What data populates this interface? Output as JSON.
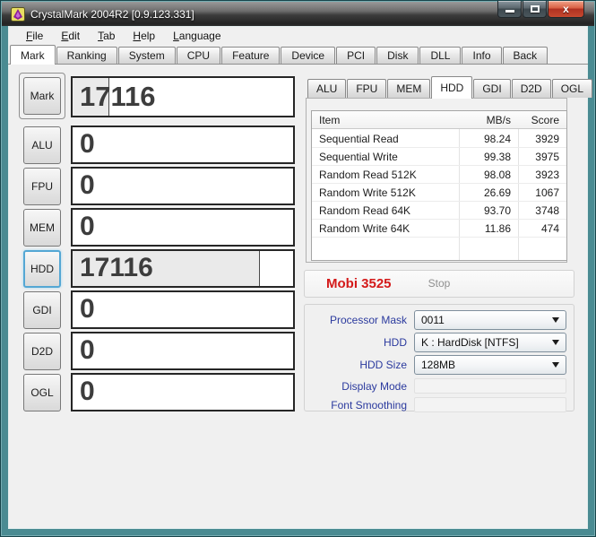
{
  "window": {
    "title": "CrystalMark 2004R2 [0.9.123.331]",
    "icons": [
      "app-icon",
      "minimize-icon",
      "maximize-icon",
      "close-icon",
      "dropdown-arrow-icon"
    ],
    "close_glyph": "x"
  },
  "menu": {
    "items": [
      {
        "mnemonic": "F",
        "rest": "ile"
      },
      {
        "mnemonic": "E",
        "rest": "dit"
      },
      {
        "mnemonic": "T",
        "rest": "ab"
      },
      {
        "mnemonic": "H",
        "rest": "elp"
      },
      {
        "mnemonic": "L",
        "rest": "anguage"
      }
    ]
  },
  "main_tabs": {
    "items": [
      "Mark",
      "Ranking",
      "System",
      "CPU",
      "Feature",
      "Device",
      "PCI",
      "Disk",
      "DLL",
      "Info",
      "Back"
    ],
    "active": "Mark"
  },
  "left_panel": {
    "rows": [
      {
        "button": "Mark",
        "value": "17116",
        "fill": 16.5
      },
      {
        "button": "ALU",
        "value": "0",
        "fill": 0
      },
      {
        "button": "FPU",
        "value": "0",
        "fill": 0
      },
      {
        "button": "MEM",
        "value": "0",
        "fill": 0
      },
      {
        "button": "HDD",
        "value": "17116",
        "fill": 85
      },
      {
        "button": "GDI",
        "value": "0",
        "fill": 0
      },
      {
        "button": "D2D",
        "value": "0",
        "fill": 0
      },
      {
        "button": "OGL",
        "value": "0",
        "fill": 0
      }
    ]
  },
  "results": {
    "tabs": [
      "ALU",
      "FPU",
      "MEM",
      "HDD",
      "GDI",
      "D2D",
      "OGL"
    ],
    "active": "HDD",
    "table": {
      "headers": [
        "Item",
        "MB/s",
        "Score"
      ],
      "rows": [
        [
          "Sequential Read",
          "98.24",
          "3929"
        ],
        [
          "Sequential Write",
          "99.38",
          "3975"
        ],
        [
          "Random Read 512K",
          "98.08",
          "3923"
        ],
        [
          "Random Write 512K",
          "26.69",
          "1067"
        ],
        [
          "Random Read 64K",
          "93.70",
          "3748"
        ],
        [
          "Random Write 64K",
          "11.86",
          "474"
        ]
      ]
    }
  },
  "run": {
    "name": "Mobi 3525",
    "action": "Stop"
  },
  "settings": {
    "rows": [
      {
        "label": "Processor Mask",
        "value": "0011",
        "enabled": true
      },
      {
        "label": "HDD",
        "value": "K : HardDisk [NTFS]",
        "enabled": true
      },
      {
        "label": "HDD Size",
        "value": "128MB",
        "enabled": true
      },
      {
        "label": "Display Mode",
        "value": "",
        "enabled": false
      },
      {
        "label": "Font Smoothing",
        "value": "",
        "enabled": false
      }
    ]
  },
  "colors": {
    "accent_red": "#d41a1a",
    "label_blue": "#2b3a9e",
    "frame_teal": "#4a8b92"
  }
}
